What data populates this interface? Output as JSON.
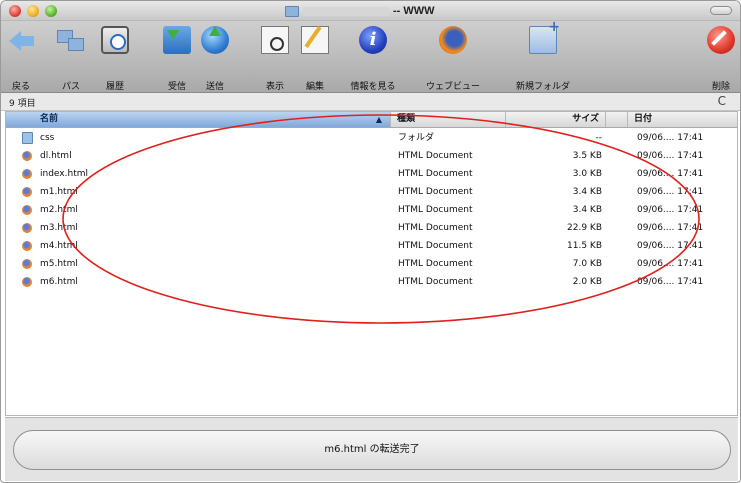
{
  "window": {
    "title_suffix": "-- WWW"
  },
  "toolbar": {
    "items": [
      {
        "label": "戻る",
        "icon": "back-arrow-icon"
      },
      {
        "label": "パス",
        "icon": "path-folders-icon"
      },
      {
        "label": "履歴",
        "icon": "history-clock-icon"
      },
      {
        "label": "受信",
        "icon": "receive-download-icon"
      },
      {
        "label": "送信",
        "icon": "send-upload-globe-icon"
      },
      {
        "label": "表示",
        "icon": "view-document-icon"
      },
      {
        "label": "編集",
        "icon": "edit-pencil-icon"
      },
      {
        "label": "情報を見る",
        "icon": "info-icon"
      },
      {
        "label": "ウェブビュー",
        "icon": "firefox-web-icon"
      },
      {
        "label": "新規フォルダ",
        "icon": "new-folder-icon"
      },
      {
        "label": "削除",
        "icon": "delete-icon"
      }
    ]
  },
  "info": {
    "item_count": "9 項目",
    "refresh_glyph": "C"
  },
  "columns": {
    "name": "名前",
    "kind": "種類",
    "size": "サイズ",
    "date": "日付"
  },
  "files": [
    {
      "name": "css",
      "kind": "フォルダ",
      "size": "--",
      "date": "09/06.... 17:41",
      "type": "folder"
    },
    {
      "name": "dl.html",
      "kind": "HTML Document",
      "size": "3.5 KB",
      "date": "09/06.... 17:41",
      "type": "html"
    },
    {
      "name": "index.html",
      "kind": "HTML Document",
      "size": "3.0 KB",
      "date": "09/06.... 17:41",
      "type": "html"
    },
    {
      "name": "m1.html",
      "kind": "HTML Document",
      "size": "3.4 KB",
      "date": "09/06.... 17:41",
      "type": "html"
    },
    {
      "name": "m2.html",
      "kind": "HTML Document",
      "size": "3.4 KB",
      "date": "09/06.... 17:41",
      "type": "html"
    },
    {
      "name": "m3.html",
      "kind": "HTML Document",
      "size": "22.9 KB",
      "date": "09/06.... 17:41",
      "type": "html"
    },
    {
      "name": "m4.html",
      "kind": "HTML Document",
      "size": "11.5 KB",
      "date": "09/06.... 17:41",
      "type": "html"
    },
    {
      "name": "m5.html",
      "kind": "HTML Document",
      "size": "7.0 KB",
      "date": "09/06.... 17:41",
      "type": "html"
    },
    {
      "name": "m6.html",
      "kind": "HTML Document",
      "size": "2.0 KB",
      "date": "09/06.... 17:41",
      "type": "html"
    }
  ],
  "status": {
    "message": "m6.html の転送完了"
  },
  "annotation": {
    "color": "#e0201a"
  }
}
